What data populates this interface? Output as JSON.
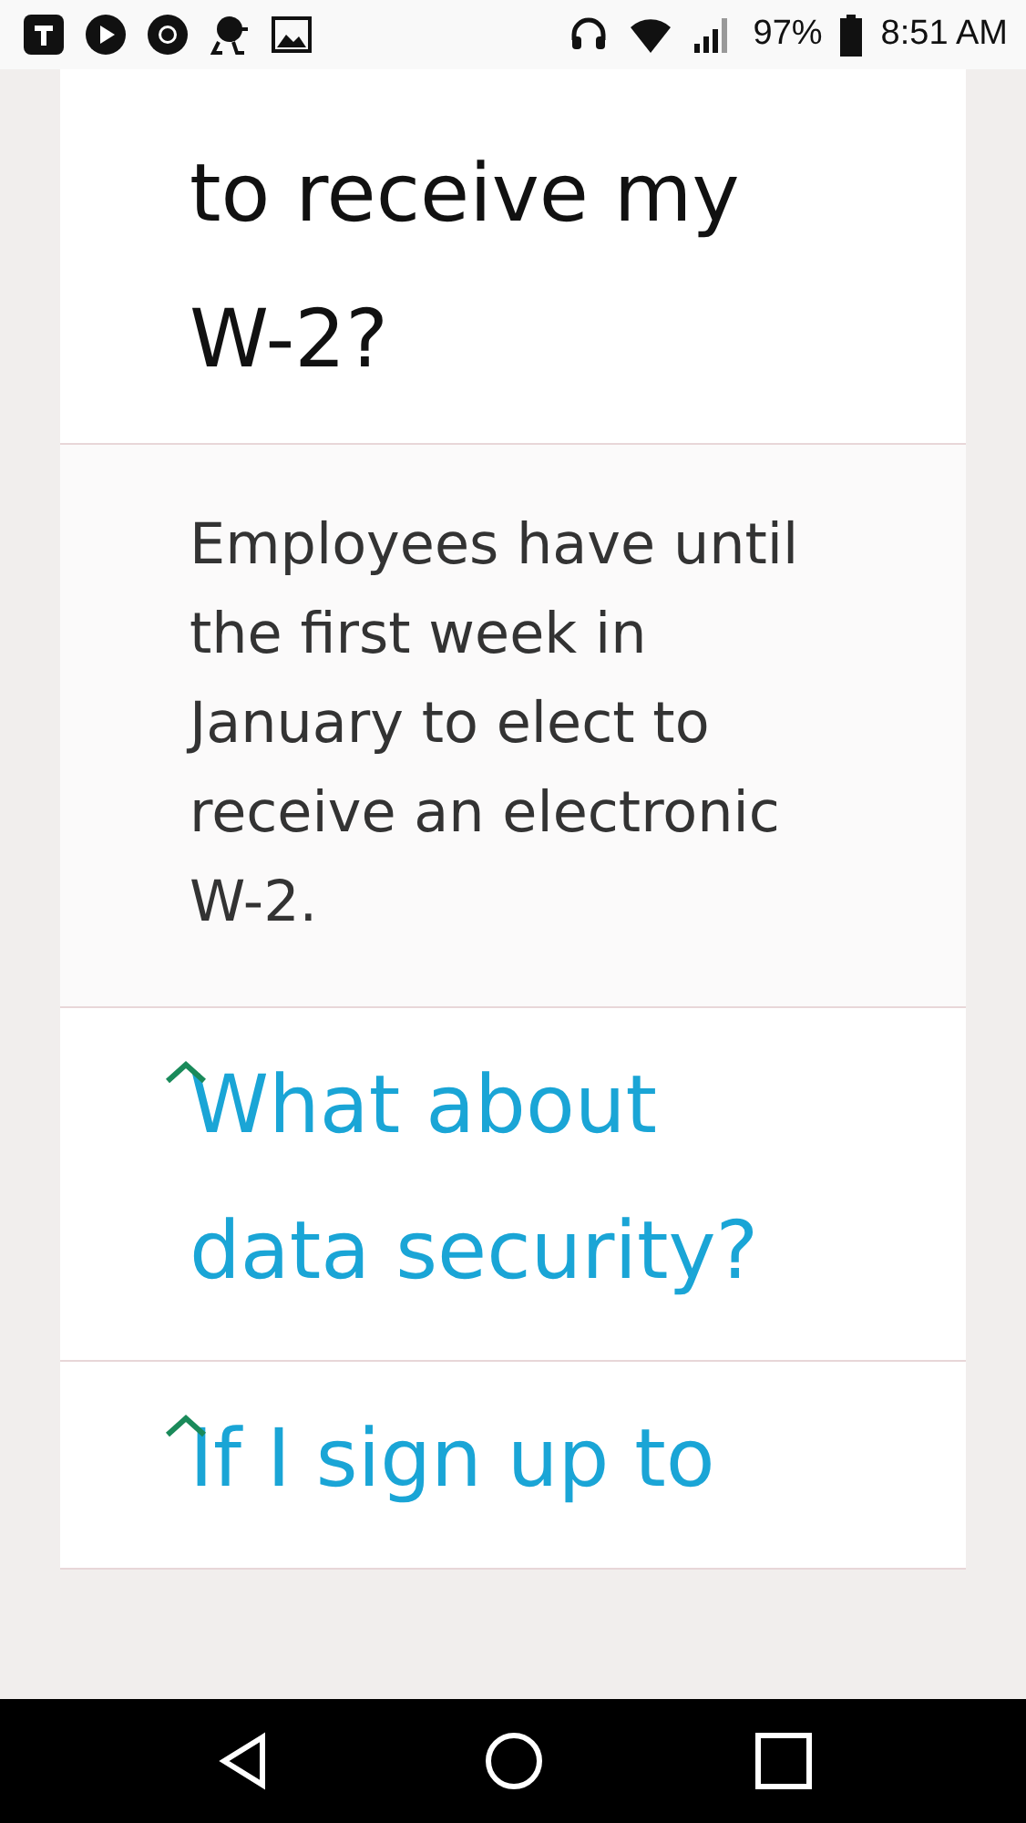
{
  "status_bar": {
    "battery": "97%",
    "time": "8:51 AM"
  },
  "faq": [
    {
      "kind": "question-tail",
      "text": "to receive my W-2?"
    },
    {
      "kind": "answer",
      "text": "Employees have until the first week in January to elect to receive an electronic W-2."
    },
    {
      "kind": "question",
      "text": "What about data security?"
    },
    {
      "kind": "question",
      "text": "If I sign up to"
    }
  ]
}
